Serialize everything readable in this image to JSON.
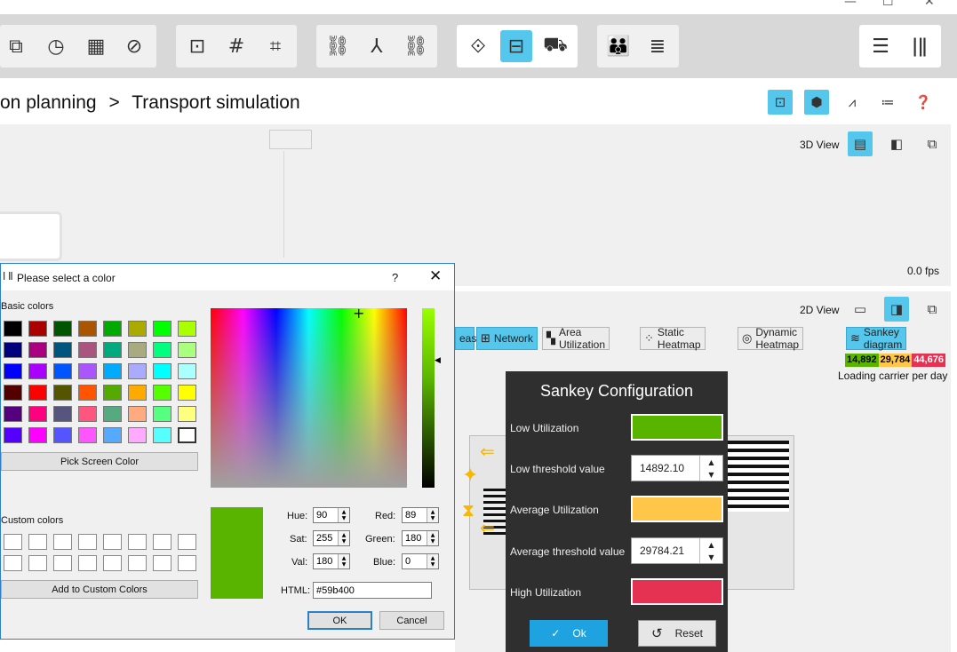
{
  "window": {
    "minimize": "—",
    "maximize": "☐",
    "close": "✕"
  },
  "breadcrumb": {
    "parent": "on planning",
    "separator": ">",
    "current": "Transport simulation"
  },
  "view3d": {
    "label": "3D View",
    "fps": "0.0 fps"
  },
  "view2d": {
    "label": "2D View"
  },
  "tabs": [
    {
      "icon": "",
      "label": "eas"
    },
    {
      "icon": "⊞",
      "label": "Network"
    },
    {
      "icon": "▚",
      "label": "Area Utilization"
    },
    {
      "icon": "⁘",
      "label": "Static Heatmap"
    },
    {
      "icon": "◎",
      "label": "Dynamic Heatmap"
    },
    {
      "icon": "≋",
      "label": "Sankey diagram"
    }
  ],
  "legend": {
    "low": {
      "value": "14,892",
      "color": "#59b400"
    },
    "avg": {
      "value": "29,784",
      "color": "#ffc64a"
    },
    "high": {
      "value": "44,676",
      "color": "#e63252"
    },
    "caption": "Loading carrier per day"
  },
  "sankey": {
    "title": "Sankey Configuration",
    "low_label": "Low Utilization",
    "low_color": "#59b400",
    "low_threshold_label": "Low threshold value",
    "low_threshold_value": "14892.10",
    "avg_label": "Average Utilization",
    "avg_color": "#ffc64a",
    "avg_threshold_label": "Average threshold value",
    "avg_threshold_value": "29784.21",
    "high_label": "High Utilization",
    "high_color": "#e63252",
    "ok_label": "Ok",
    "reset_label": "Reset"
  },
  "color_dialog": {
    "title": "Please select a color",
    "help": "?",
    "close": "✕",
    "basic_colors_label": "Basic colors",
    "basic_colors": [
      [
        "#000000",
        "#aa0000",
        "#005500",
        "#aa5500",
        "#00aa00",
        "#aaaa00",
        "#00ff00",
        "#aaff00"
      ],
      [
        "#00007f",
        "#aa007f",
        "#00557f",
        "#aa557f",
        "#00aa7f",
        "#aaaa7f",
        "#00ff7f",
        "#aaff7f"
      ],
      [
        "#0000ff",
        "#aa00ff",
        "#0055ff",
        "#aa55ff",
        "#00aaff",
        "#aaaaff",
        "#00ffff",
        "#aaffff"
      ],
      [
        "#550000",
        "#ff0000",
        "#555500",
        "#ff5500",
        "#55aa00",
        "#ffaa00",
        "#55ff00",
        "#ffff00"
      ],
      [
        "#55007f",
        "#ff007f",
        "#55557f",
        "#ff557f",
        "#55aa7f",
        "#ffaa7f",
        "#55ff7f",
        "#ffff7f"
      ],
      [
        "#5500ff",
        "#ff00ff",
        "#5555ff",
        "#ff55ff",
        "#55aaff",
        "#ffaaff",
        "#55ffff",
        "#ffffff"
      ]
    ],
    "pick_screen_label": "Pick Screen Color",
    "custom_colors_label": "Custom colors",
    "add_custom_label": "Add to Custom Colors",
    "current_color": "#59b400",
    "hue_label": "Hue:",
    "hue": "90",
    "sat_label": "Sat:",
    "sat": "255",
    "val_label": "Val:",
    "val": "180",
    "red_label": "Red:",
    "red": "89",
    "green_label": "Green:",
    "green": "180",
    "blue_label": "Blue:",
    "blue": "0",
    "html_label": "HTML:",
    "html": "#59b400",
    "ok_label": "OK",
    "cancel_label": "Cancel"
  }
}
